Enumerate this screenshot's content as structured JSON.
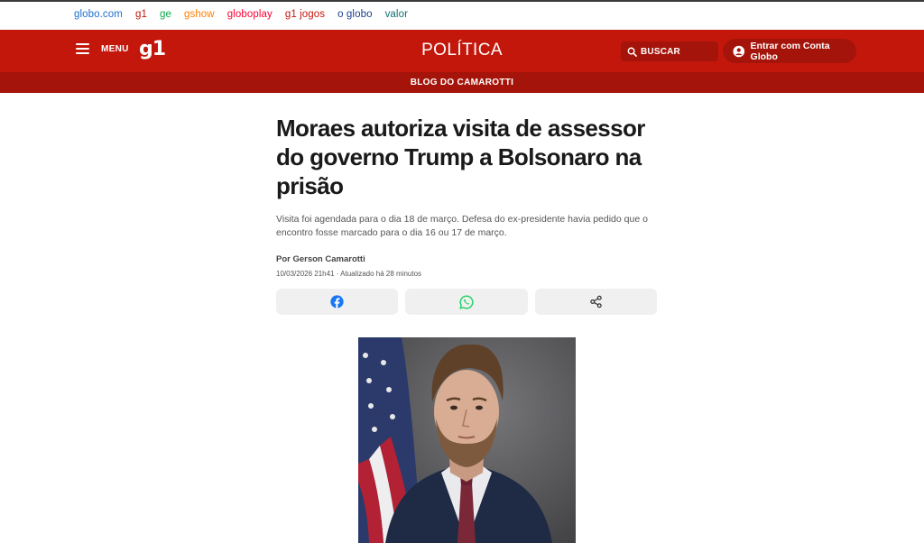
{
  "globo_bar": {
    "links": [
      {
        "label": "globo.com",
        "color": "#1e6fd1"
      },
      {
        "label": "g1",
        "color": "#c4170c"
      },
      {
        "label": "ge",
        "color": "#06aa48"
      },
      {
        "label": "gshow",
        "color": "#ff7f00"
      },
      {
        "label": "globoplay",
        "color": "#fb0234"
      },
      {
        "label": "g1 jogos",
        "color": "#c4170c"
      },
      {
        "label": "o globo",
        "color": "#1c3f8a"
      },
      {
        "label": "valor",
        "color": "#0e6f6f"
      }
    ]
  },
  "header": {
    "menu_label": "MENU",
    "logo": "g1",
    "section": "POLÍTICA",
    "search_label": "BUSCAR",
    "login_label": "Entrar com Conta Globo",
    "colors": {
      "primary": "#c4170c",
      "dark": "#a5140a"
    }
  },
  "blog": {
    "name": "BLOG DO CAMAROTTI"
  },
  "article": {
    "headline": "Moraes autoriza visita de assessor do governo Trump a Bolsonaro na prisão",
    "subtitle": "Visita foi agendada para o dia 18 de março. Defesa do ex-presidente havia pedido que o encontro fosse marcado para o dia 16 ou 17 de março.",
    "author": "Por Gerson Camarotti",
    "dateline": "10/03/2026 21h41 · Atualizado há 28 minutos"
  },
  "share": {
    "buttons": [
      {
        "icon": "facebook-icon",
        "color": "#1877f2"
      },
      {
        "icon": "whatsapp-icon",
        "color": "#25d366"
      },
      {
        "icon": "share-icon",
        "color": "#333333"
      }
    ]
  }
}
